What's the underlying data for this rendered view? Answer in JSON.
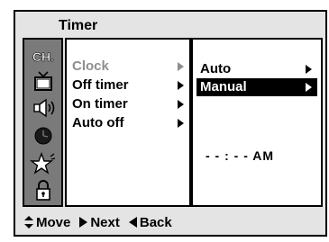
{
  "menu": {
    "title": "Timer",
    "items": [
      {
        "label": "Clock",
        "active": true
      },
      {
        "label": "Off timer"
      },
      {
        "label": "On timer"
      },
      {
        "label": "Auto off"
      }
    ]
  },
  "submenu": {
    "items": [
      {
        "label": "Auto"
      },
      {
        "label": "Manual",
        "selected": true
      }
    ],
    "time_value": "- - : - -  AM"
  },
  "sidebar": {
    "icons": [
      "channel-icon",
      "tv-icon",
      "speaker-icon",
      "clock-icon",
      "star-icon",
      "lock-icon"
    ],
    "channel_label": "CH."
  },
  "footer": {
    "move_label": "Move",
    "next_label": "Next",
    "back_label": "Back"
  },
  "colors": {
    "panel_bg": "#ffffff",
    "sidebar_bg": "#7a7a7a",
    "selected_bg": "#000000",
    "inactive_text": "#8e8e8e"
  }
}
